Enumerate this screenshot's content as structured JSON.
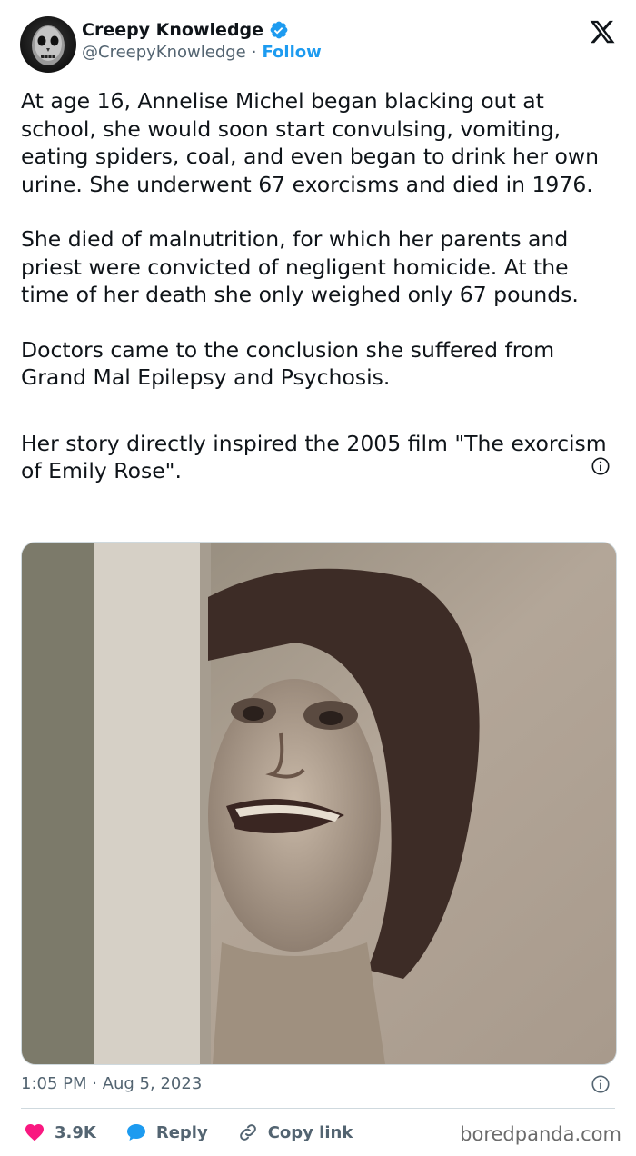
{
  "author": {
    "display_name": "Creepy Knowledge",
    "handle": "@CreepyKnowledge",
    "separator": "·",
    "follow_label": "Follow",
    "verified": true,
    "avatar_icon": "skull-mask-avatar"
  },
  "platform_icon": "x-logo-icon",
  "tweet": {
    "paragraphs": [
      "At age 16, Annelise Michel began blacking out at school, she would soon start convulsing, vomiting, eating spiders, coal, and even began to drink her own urine. She underwent 67 exorcisms and died in 1976.",
      "She died of malnutrition, for which her parents and priest were convicted of negligent homicide. At the time of her death she only weighed only 67 pounds.",
      "Doctors came to the conclusion she suffered from Grand Mal Epilepsy and Psychosis.",
      "Her story directly inspired the 2005 film \"The exorcism of Emily Rose\"."
    ]
  },
  "meta": {
    "timestamp": "1:05 PM · Aug 5, 2023"
  },
  "actions": {
    "likes_count": "3.9K",
    "reply_label": "Reply",
    "copy_link_label": "Copy link"
  },
  "watermark": "boredpanda.com",
  "colors": {
    "accent": "#1d9bf0",
    "like": "#f91880",
    "text_primary": "#0f1419",
    "text_secondary": "#536471"
  }
}
